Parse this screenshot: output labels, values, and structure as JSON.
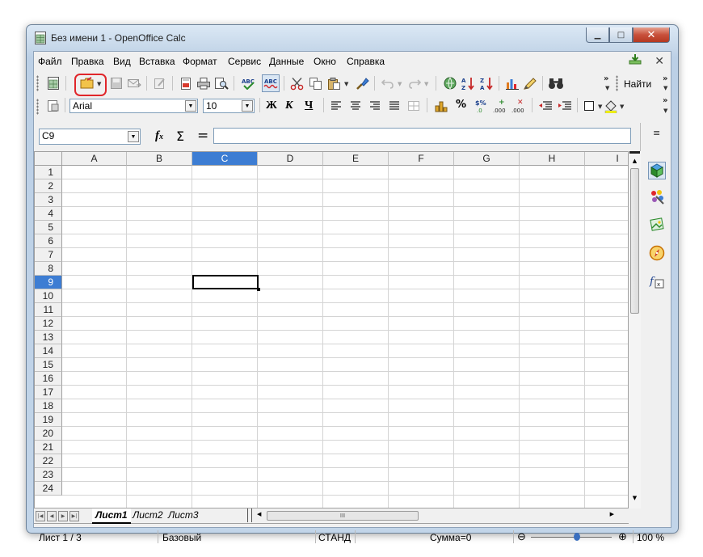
{
  "window": {
    "title": "Без имени 1 - OpenOffice Calc"
  },
  "menu": [
    {
      "label": "Файл",
      "id": "file"
    },
    {
      "label": "Правка",
      "id": "edit"
    },
    {
      "label": "Вид",
      "id": "view"
    },
    {
      "label": "Вставка",
      "id": "insert"
    },
    {
      "label": "Формат",
      "id": "format"
    },
    {
      "label": "Сервис",
      "id": "tools"
    },
    {
      "label": "Данные",
      "id": "data"
    },
    {
      "label": "Окно",
      "id": "window"
    },
    {
      "label": "Справка",
      "id": "help"
    }
  ],
  "toolbar": {
    "find_label": "Найти"
  },
  "format": {
    "font_name": "Arial",
    "font_size": "10",
    "bold": "Ж",
    "italic": "К",
    "underline": "Ч"
  },
  "formula": {
    "name_box": "C9",
    "content": ""
  },
  "columns": [
    "A",
    "B",
    "C",
    "D",
    "E",
    "F",
    "G",
    "H",
    "I"
  ],
  "selected_column": "C",
  "rows": [
    "1",
    "2",
    "3",
    "4",
    "5",
    "6",
    "7",
    "8",
    "9",
    "10",
    "11",
    "12",
    "13",
    "14",
    "15",
    "16",
    "17",
    "18",
    "19",
    "20",
    "21",
    "22",
    "23",
    "24"
  ],
  "selected_row": "9",
  "sheets": [
    "Лист1",
    "Лист2",
    "Лист3"
  ],
  "active_sheet": "Лист1",
  "status": {
    "sheet": "Лист 1 / 3",
    "style": "Базовый",
    "mode": "СТАНД",
    "sum": "Сумма=0",
    "zoom": "100 %"
  },
  "highlight_color": "#e0262b",
  "selection_color": "#3d7dd3"
}
